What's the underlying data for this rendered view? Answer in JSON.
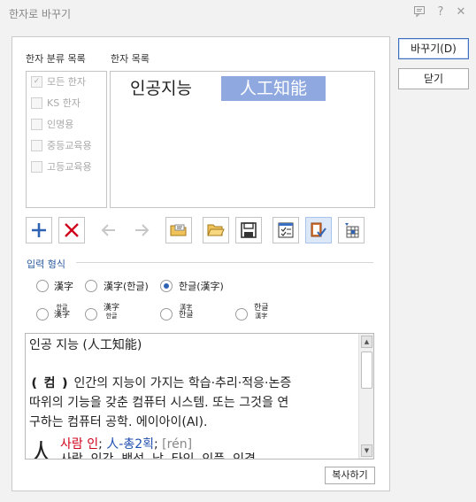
{
  "window": {
    "title": "한자로 바꾸기"
  },
  "side_buttons": {
    "convert_label": "바꾸기(D)",
    "close_label": "닫기"
  },
  "categories": {
    "header": "한자 분류 목록",
    "items": [
      {
        "label": "모든 한자",
        "checked": true
      },
      {
        "label": "KS 한자",
        "checked": false
      },
      {
        "label": "인명용",
        "checked": false
      },
      {
        "label": "중등교육용",
        "checked": false
      },
      {
        "label": "고등교육용",
        "checked": false
      }
    ]
  },
  "hanja_list": {
    "header": "한자 목록",
    "source_word": "인공지능",
    "candidate": "人工知能",
    "highlight_color": "#8fa9e0"
  },
  "toolbar": {
    "icons": [
      "add-icon",
      "delete-icon",
      "arrow-left-icon",
      "arrow-right-icon",
      "open-folder-text-icon",
      "open-folder-icon",
      "save-icon",
      "checklist-icon",
      "book-check-icon",
      "grid-import-icon"
    ]
  },
  "input_format": {
    "label": "입력 형식",
    "row1": [
      {
        "label": "漢字",
        "selected": false
      },
      {
        "label": "漢字(한글)",
        "selected": false
      },
      {
        "label": "한글(漢字)",
        "selected": true
      }
    ],
    "row2": [
      {
        "top": "한글",
        "bottom": "漢字",
        "selected": false
      },
      {
        "top": "漢字",
        "bottom": "한글",
        "selected": false
      },
      {
        "top": "漢字",
        "bottom": "한글",
        "selected": false
      },
      {
        "top": "한글",
        "bottom": "漢字",
        "selected": false
      }
    ]
  },
  "result": {
    "line1": "인공 지능 (人工知能)",
    "line2_tag": "❪ 컴 ❫",
    "line2": " 인간의 지능이 가지는 학습·추리·적응·논증",
    "line3": "따위의 기능을 갖춘 컴퓨터 시스템. 또는 그것을 연",
    "line4": "구하는 컴퓨터 공학. 에이아이(AI).",
    "hanja_char": "人",
    "hanja_meaning": "사람 인",
    "hanja_sep": "; ",
    "hanja_radical": "人-총2획",
    "hanja_sep2": "; ",
    "hanja_pinyin": "[rén]",
    "hanja_line2": "사람, 인간, 백성, 남, 타인, 인품, 인격"
  },
  "copy_button": {
    "label": "복사하기"
  },
  "colors": {
    "accent": "#2f62b3",
    "meaning_red": "#d0021b",
    "radical_blue": "#1f4fb0"
  }
}
